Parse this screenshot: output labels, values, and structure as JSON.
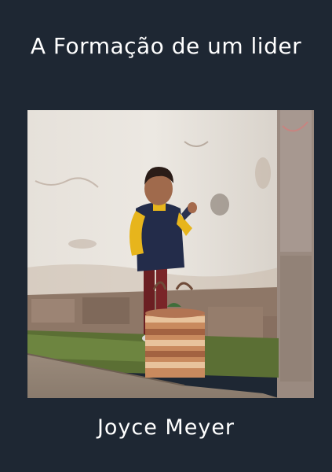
{
  "book": {
    "title": "A Formação de um lider",
    "author": "Joyce Meyer"
  },
  "colors": {
    "background": "#1e2733",
    "text": "#ffffff"
  }
}
